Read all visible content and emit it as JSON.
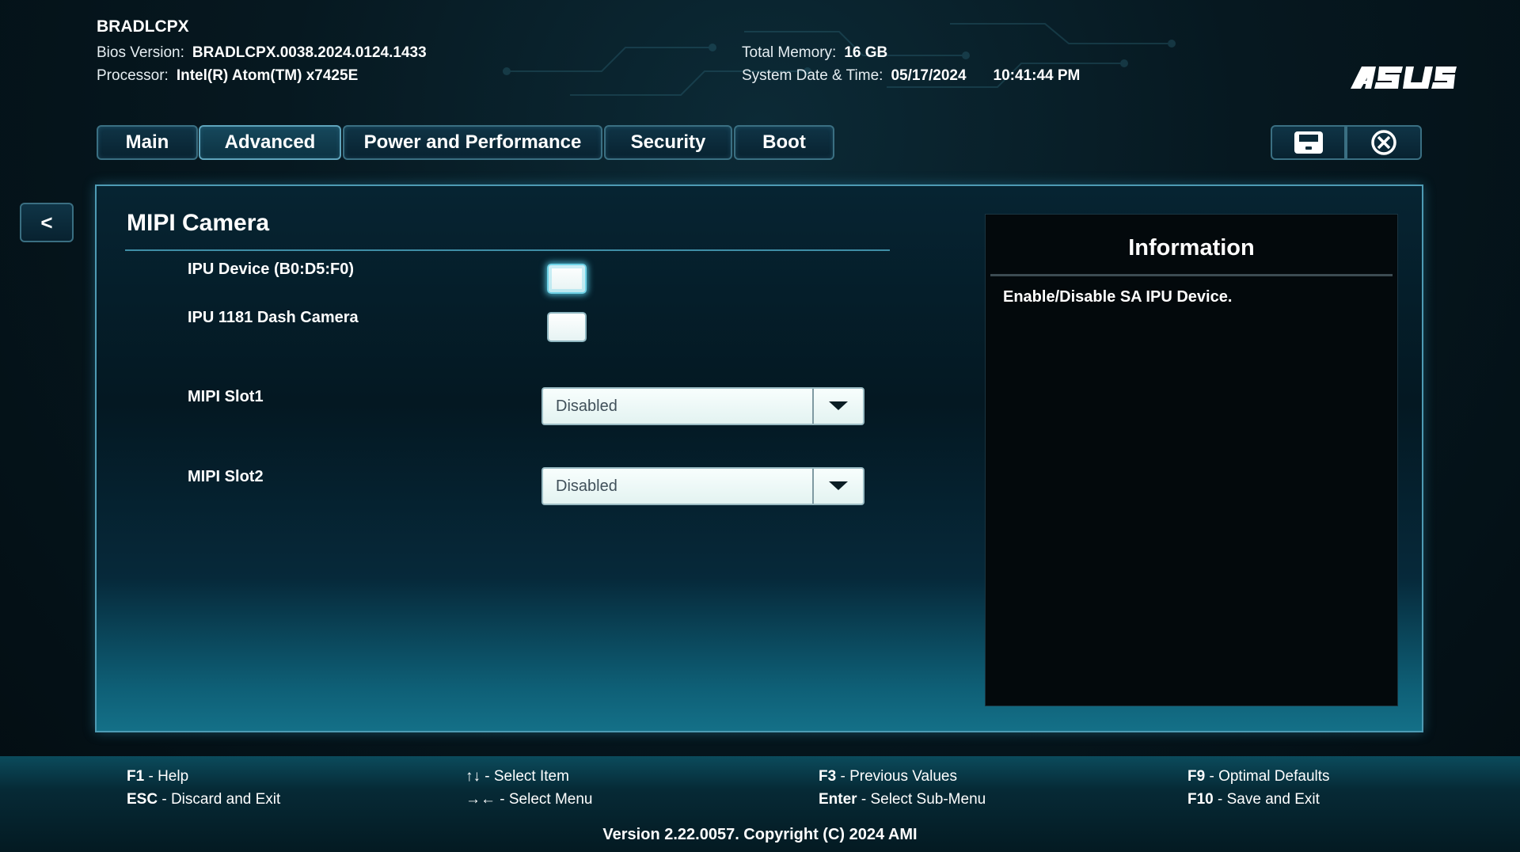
{
  "header": {
    "product": "BRADLCPX",
    "bios_version_label": "Bios Version:",
    "bios_version": "BRADLCPX.0038.2024.0124.1433",
    "processor_label": "Processor:",
    "processor": "Intel(R) Atom(TM) x7425E",
    "memory_label": "Total Memory:",
    "memory": "16 GB",
    "datetime_label": "System Date & Time:",
    "date": "05/17/2024",
    "time": "10:41:44 PM",
    "logo_text": "ASUS"
  },
  "tabs": [
    {
      "label": "Main",
      "active": false
    },
    {
      "label": "Advanced",
      "active": true
    },
    {
      "label": "Power and Performance",
      "active": false
    },
    {
      "label": "Security",
      "active": false
    },
    {
      "label": "Boot",
      "active": false
    }
  ],
  "toolbar": {
    "save_icon": "save-icon",
    "close_icon": "close-circle-icon"
  },
  "back_button": "<",
  "page": {
    "title": "MIPI Camera",
    "items": [
      {
        "label": "IPU Device (B0:D5:F0)",
        "type": "checkbox",
        "checked": false,
        "focused": true
      },
      {
        "label": "IPU 1181 Dash Camera",
        "type": "checkbox",
        "checked": false,
        "focused": false
      },
      {
        "label": "MIPI Slot1",
        "type": "select",
        "value": "Disabled"
      },
      {
        "label": "MIPI Slot2",
        "type": "select",
        "value": "Disabled"
      }
    ]
  },
  "info": {
    "title": "Information",
    "text": "Enable/Disable SA IPU Device."
  },
  "footer": {
    "help": [
      {
        "key": "F1",
        "desc": " - Help"
      },
      {
        "key": "ESC",
        "desc": " - Discard and Exit"
      },
      {
        "key": "↑↓",
        "desc": " - Select Item"
      },
      {
        "key": "→←",
        "desc": " - Select Menu"
      },
      {
        "key": "F3",
        "desc": " - Previous Values"
      },
      {
        "key": "Enter",
        "desc": " - Select Sub-Menu"
      },
      {
        "key": "F9",
        "desc": " - Optimal Defaults"
      },
      {
        "key": "F10",
        "desc": " - Save and Exit"
      }
    ],
    "copyright": "Version 2.22.0057. Copyright (C) 2024 AMI"
  },
  "colors": {
    "accent": "#4e9bb4",
    "background": "#061820",
    "focus_glow": "#6fd2e6"
  }
}
